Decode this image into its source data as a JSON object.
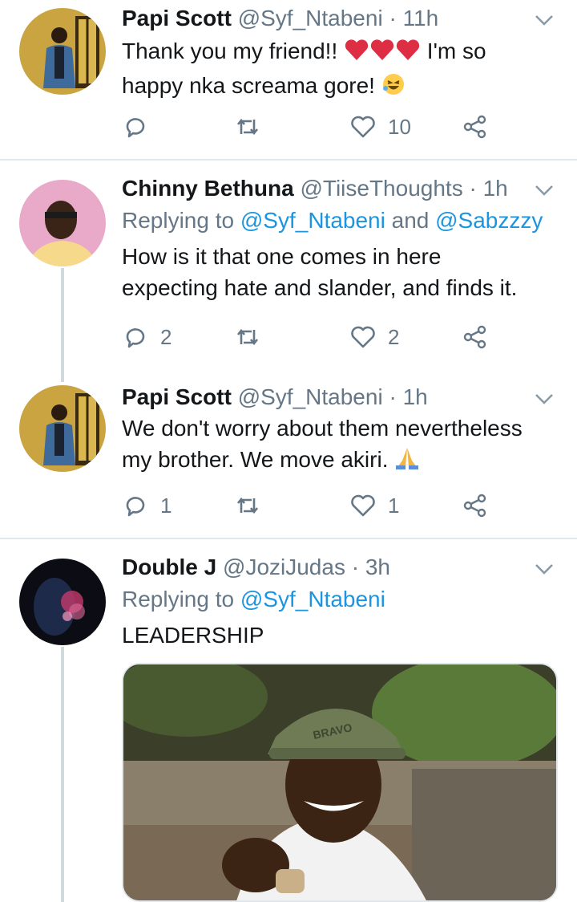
{
  "tweets": [
    {
      "name": "Papi Scott",
      "handle": "@Syf_Ntabeni",
      "time": "11h",
      "text_a": "Thank you my friend!!",
      "text_b": " I'm so",
      "text_c": "happy nka screama gore!",
      "reply": "",
      "like": "10",
      "retweet": ""
    },
    {
      "name": "Chinny Bethuna",
      "handle": "@TiiseThoughts",
      "time": "1h",
      "replying_prefix": "Replying to ",
      "replying_to_1": "@Syf_Ntabeni",
      "replying_and": " and ",
      "replying_to_2": "@Sabzzzy",
      "text_a": "How is it that one comes in here",
      "text_b": "expecting hate and slander, and finds it.",
      "reply": "2",
      "like": "2"
    },
    {
      "name": "Papi Scott",
      "handle": "@Syf_Ntabeni",
      "time": "1h",
      "text_a": "We don't worry about them nevertheless",
      "text_b": "my brother. We move akiri.",
      "reply": "1",
      "like": "1"
    },
    {
      "name": "Double J",
      "handle": "@JoziJudas",
      "time": "3h",
      "replying_prefix": "Replying to ",
      "replying_to_1": "@Syf_Ntabeni",
      "text_a": "LEADERSHIP",
      "media_cap_text": "BRAVO"
    }
  ],
  "colors": {
    "accent": "#1b95e0",
    "muted": "#657786",
    "heart": "#e0245e",
    "divider": "#e1e8ed"
  },
  "icons": [
    "reply-icon",
    "retweet-icon",
    "like-icon",
    "share-icon",
    "chevron-down-icon",
    "heart-emoji-icon",
    "laughing-emoji-icon",
    "praying-hands-emoji-icon"
  ]
}
